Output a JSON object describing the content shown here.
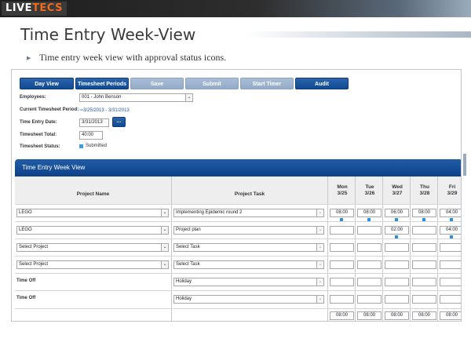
{
  "slide": {
    "logo_live": "LIVE",
    "logo_tecs": "TECS",
    "title": "Time Entry Week-View",
    "bullet": "Time entry week view with approval status icons."
  },
  "toolbar": {
    "day_view": "Day View",
    "timesheet_periods": "Timesheet Periods",
    "save": "Save",
    "submit": "Submit",
    "start_timer": "Start Timer",
    "audit": "Audit"
  },
  "form": {
    "employees_label": "Employees:",
    "employee_value": "001 - John Benson",
    "current_period_label": "Current Timesheet Period:",
    "current_period_value": "3/25/2013 - 3/31/2013",
    "entry_date_label": "Time Entry Date:",
    "entry_date_value": "3/31/2013",
    "date_button": "...",
    "total_label": "Timesheet Total:",
    "total_value": "40:00",
    "status_label": "Timesheet Status:",
    "status_value": "Submitted",
    "status_color": "#3aa0e6"
  },
  "grid": {
    "panel_title": "Time Entry Week View",
    "col_project": "Project Name",
    "col_task": "Project Task",
    "days": [
      {
        "name": "Mon",
        "date": "3/25"
      },
      {
        "name": "Tue",
        "date": "3/26"
      },
      {
        "name": "Wed",
        "date": "3/27"
      },
      {
        "name": "Thu",
        "date": "3/28"
      },
      {
        "name": "Fri",
        "date": "3/29"
      }
    ],
    "rows": [
      {
        "project": "LEGO",
        "task": "Implementing Epidemic round 2",
        "hours": [
          "08:00",
          "08:00",
          "06:00",
          "08:00",
          "04:00"
        ]
      },
      {
        "project": "LEGO",
        "task": "Project plan",
        "hours": [
          "",
          "",
          "02:00",
          "",
          "04:00"
        ]
      },
      {
        "project": "Select Project",
        "task": "Select Task",
        "hours": [
          "",
          "",
          "",
          "",
          ""
        ]
      },
      {
        "project": "Select Project",
        "task": "Select Task",
        "hours": [
          "",
          "",
          "",
          "",
          ""
        ]
      },
      {
        "project": "Time Off",
        "task": "Holiday",
        "hours": [
          "",
          "",
          "",
          "",
          ""
        ]
      },
      {
        "project": "Time Off",
        "task": "Holiday",
        "hours": [
          "",
          "",
          "",
          "",
          ""
        ]
      }
    ],
    "totals": [
      "08:00",
      "08:00",
      "08:00",
      "08:00",
      "08:00"
    ],
    "status_mark_color": "#2d8fdc"
  }
}
